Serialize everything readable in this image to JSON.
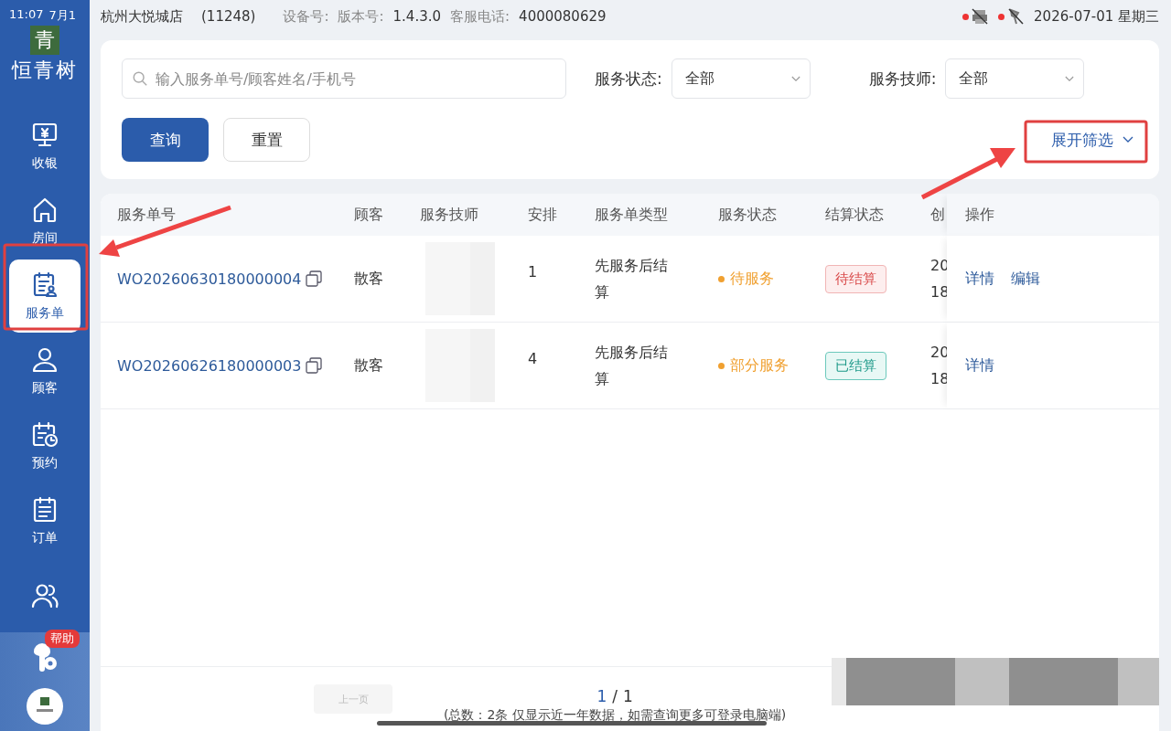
{
  "status_bar": {
    "time": "11:07",
    "date_short": "7月1",
    "store": "杭州大悦城店",
    "store_code": "(11248)",
    "device_label": "设备号:",
    "version_label": "版本号:",
    "version": "1.4.3.0",
    "hotline_label": "客服电话:",
    "hotline": "4000080629",
    "printer_offline": true,
    "scanner_offline": true,
    "date": "2026-07-01 星期三"
  },
  "sidebar": {
    "brand_mark": "青",
    "brand": "恒青树",
    "items": [
      {
        "label": "收银",
        "selected": false
      },
      {
        "label": "房间",
        "selected": false
      },
      {
        "label": "服务单",
        "selected": true
      },
      {
        "label": "顾客",
        "selected": false
      },
      {
        "label": "预约",
        "selected": false
      },
      {
        "label": "订单",
        "selected": false
      },
      {
        "selected": false
      }
    ],
    "help_badge": "帮助"
  },
  "filters": {
    "search": {
      "placeholder": "输入服务单号/顾客姓名/手机号"
    },
    "selects": [
      {
        "label": "服务状态:",
        "value": "全部"
      },
      {
        "label": "服务技师:",
        "value": "全部"
      }
    ],
    "buttons": [
      {
        "label": "查询",
        "kind": "primary"
      },
      {
        "label": "重置",
        "kind": "default"
      }
    ],
    "expand": {
      "label": "展开筛选",
      "expanded": false
    }
  },
  "table": {
    "columns": [
      "服务单号",
      "顾客",
      "服务技师",
      "安排",
      "服务单类型",
      "服务状态",
      "结算状态",
      "创",
      "操作"
    ],
    "rows": [
      {
        "order_no": "WO20260630180000004",
        "customer": "散客",
        "arrangement": "1",
        "type": "先服务后结算",
        "service_status": {
          "label": "待服务",
          "color": "#f0a030"
        },
        "settle_status": {
          "label": "待结算",
          "kind": "pending"
        },
        "created": [
          "20",
          "18"
        ],
        "actions": [
          "详情",
          "编辑"
        ]
      },
      {
        "order_no": "WO20260626180000003",
        "customer": "散客",
        "arrangement": "4",
        "type": "先服务后结算",
        "service_status": {
          "label": "部分服务",
          "color": "#f0a030"
        },
        "settle_status": {
          "label": "已结算",
          "kind": "settled"
        },
        "created": [
          "20",
          "18"
        ],
        "actions": [
          "详情"
        ]
      }
    ]
  },
  "pagination": {
    "prev": {
      "label": "上一页",
      "disabled": true
    },
    "current": "1",
    "separator": "/",
    "total": "1",
    "summary": "(总数：2条 仅显示近一年数据，如需查询更多可登录电脑端)"
  }
}
